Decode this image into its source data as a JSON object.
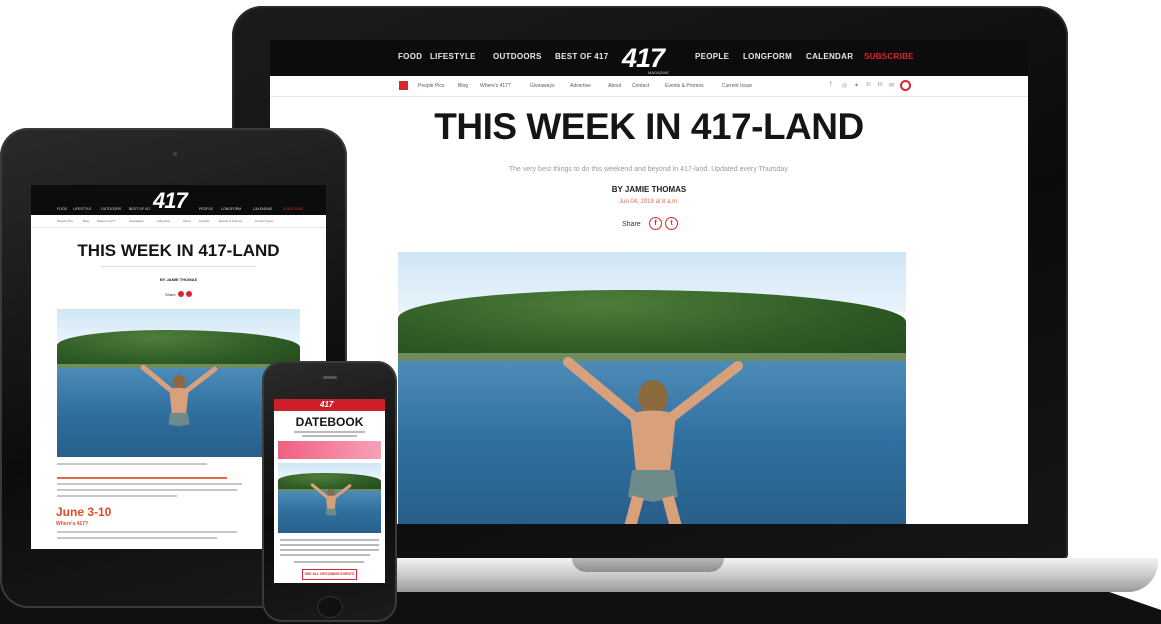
{
  "site": {
    "logo": "417",
    "logo_sub": "MAGAZINE",
    "topnav": [
      "FOOD",
      "LIFESTYLE",
      "OUTDOORS",
      "BEST OF 417",
      "PEOPLE",
      "LONGFORM",
      "CALENDAR",
      "SUBSCRIBE"
    ],
    "subnav": [
      "People Pics",
      "Blog",
      "Where's 417?",
      "Giveaways",
      "Advertise",
      "About",
      "Contact",
      "Events & Promos",
      "Current Issue"
    ]
  },
  "article": {
    "title": "THIS WEEK IN 417-LAND",
    "description": "The very best things to do this weekend and beyond in 417-land. Updated every Thursday.",
    "byline": "BY JAMIE THOMAS",
    "date": "Jun 04, 2019 at 8 a.m.",
    "share_label": "Share",
    "date_heading": "June 3-10",
    "sub_heading": "Where's 417?"
  },
  "phone": {
    "title": "DATEBOOK",
    "cta": "SEE ALL UPCOMING EVENTS"
  },
  "colors": {
    "brand_red": "#d9262c",
    "accent_orange": "#e0694a",
    "nav_black": "#0c0c0c"
  }
}
